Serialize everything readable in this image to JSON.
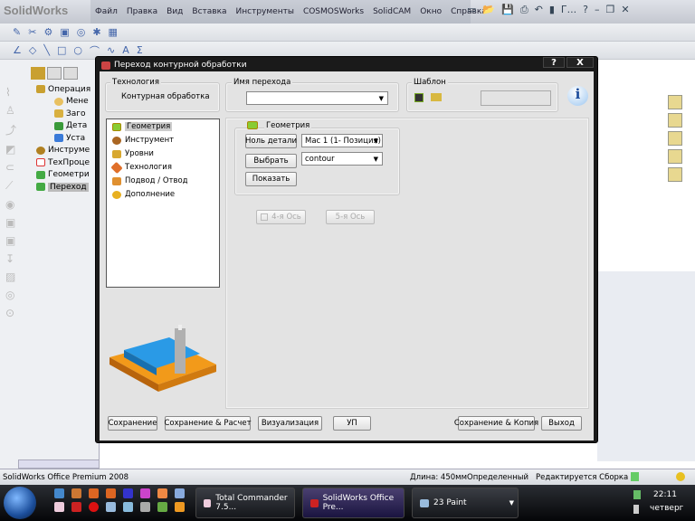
{
  "app": {
    "logo": "SolidWorks",
    "menu": [
      "Файл",
      "Правка",
      "Вид",
      "Вставка",
      "Инструменты",
      "COSMOSWorks",
      "SolidCAM",
      "Окно",
      "Справка"
    ],
    "quick_text": "Г..."
  },
  "tree": {
    "items": [
      "Операция",
      "Мене",
      "Заго",
      "Дета",
      "Уста",
      "Инструме",
      "ТехПроце",
      "Геометри",
      "Переход"
    ]
  },
  "dialog": {
    "title": "Переход контурной обработки",
    "help": "?",
    "close": "X",
    "tech_label": "Технология",
    "tech_value": "Контурная обработка",
    "name_label": "Имя перехода",
    "name_value": "",
    "template_label": "Шаблон",
    "template_value": "",
    "nav": [
      "Геометрия",
      "Инструмент",
      "Уровни",
      "Технология",
      "Подвод / Отвод",
      "Дополнение"
    ],
    "geom": {
      "title": "Геометрия",
      "zero_btn": "Ноль детали",
      "zero_value": "Мас 1 (1- Позиция)",
      "select_btn": "Выбрать",
      "select_value": "contour",
      "show_btn": "Показать"
    },
    "axis4": "4-я Ось",
    "axis5": "5-я Ось",
    "buttons": {
      "save": "Сохранение",
      "save_calc": "Сохранение & Расчет",
      "visual": "Визуализация",
      "gcode": "УП",
      "save_copy": "Сохранение & Копия",
      "exit": "Выход"
    }
  },
  "status": {
    "product": "SolidWorks Office Premium 2008",
    "length": "Длина: 450мм",
    "state": "Определенный",
    "mode": "Редактируется Сборка"
  },
  "taskbar": {
    "items": [
      "Total Commander 7.5...",
      "SolidWorks Office Pre...",
      "23 Paint"
    ],
    "time": "22:11",
    "day": "четверг"
  }
}
